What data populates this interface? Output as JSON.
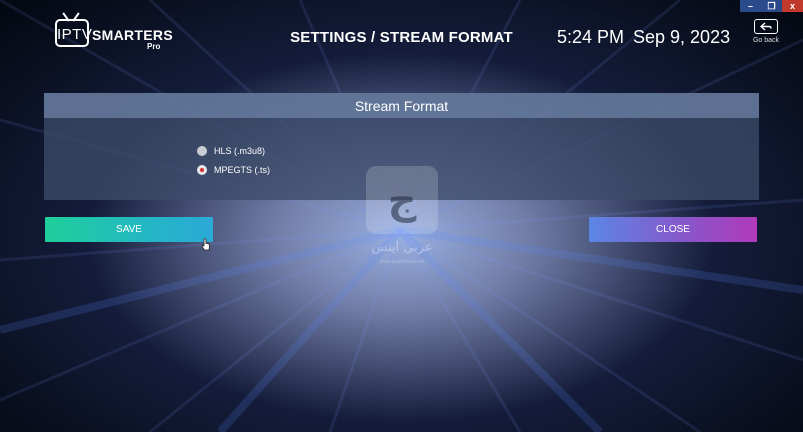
{
  "window": {
    "minimize": "–",
    "restore": "❐",
    "close": "x"
  },
  "header": {
    "logo_iptv": "IPTV",
    "logo_smarters": "SMARTERS",
    "logo_pro": "Pro",
    "title": "SETTINGS / STREAM FORMAT",
    "time": "5:24 PM",
    "date": "Sep 9, 2023",
    "go_back_label": "Go back",
    "go_back_icon": "back-arrow-icon"
  },
  "panel": {
    "title": "Stream Format",
    "options": [
      {
        "label": "HLS (.m3u8)",
        "selected": false
      },
      {
        "label": "MPEGTS (.ts)",
        "selected": true
      }
    ]
  },
  "watermark": {
    "text": "عربي ايتس",
    "sub": "www.arabicitnes.net"
  },
  "buttons": {
    "save": "SAVE",
    "close": "CLOSE"
  },
  "colors": {
    "save_gradient_start": "#1fcf9a",
    "save_gradient_end": "#2aa9d6",
    "close_gradient_start": "#5b86e5",
    "close_gradient_end": "#b03aba",
    "radio_selected_dot": "#d4322c"
  }
}
